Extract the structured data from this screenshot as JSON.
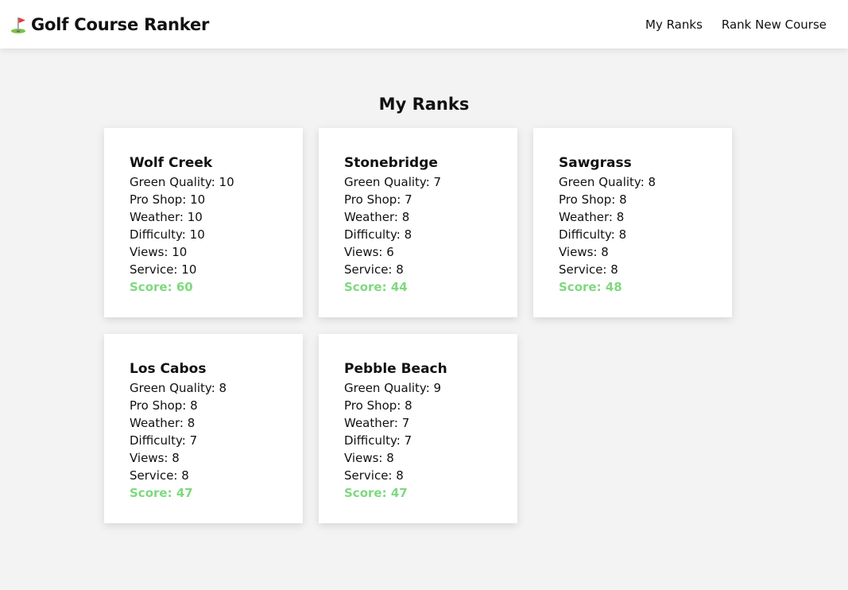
{
  "header": {
    "title": "Golf Course Ranker",
    "nav": [
      {
        "label": "My Ranks"
      },
      {
        "label": "Rank New Course"
      }
    ]
  },
  "main": {
    "title": "My Ranks",
    "labels": {
      "green_quality": "Green Quality:",
      "pro_shop": "Pro Shop:",
      "weather": "Weather:",
      "difficulty": "Difficulty:",
      "views": "Views:",
      "service": "Service:",
      "score": "Score:"
    },
    "courses": [
      {
        "name": "Wolf Creek",
        "green_quality": "10",
        "pro_shop": "10",
        "weather": "10",
        "difficulty": "10",
        "views": "10",
        "service": "10",
        "score": "60"
      },
      {
        "name": "Stonebridge",
        "green_quality": "7",
        "pro_shop": "7",
        "weather": "8",
        "difficulty": "8",
        "views": "6",
        "service": "8",
        "score": "44"
      },
      {
        "name": "Sawgrass",
        "green_quality": "8",
        "pro_shop": "8",
        "weather": "8",
        "difficulty": "8",
        "views": "8",
        "service": "8",
        "score": "48"
      },
      {
        "name": "Los Cabos",
        "green_quality": "8",
        "pro_shop": "8",
        "weather": "8",
        "difficulty": "7",
        "views": "8",
        "service": "8",
        "score": "47"
      },
      {
        "name": "Pebble Beach",
        "green_quality": "9",
        "pro_shop": "8",
        "weather": "7",
        "difficulty": "7",
        "views": "8",
        "service": "8",
        "score": "47"
      }
    ]
  },
  "colors": {
    "score": "#7fd97f",
    "background": "#f3f3f3"
  },
  "icons": {
    "brand": "golf-flag-icon"
  }
}
